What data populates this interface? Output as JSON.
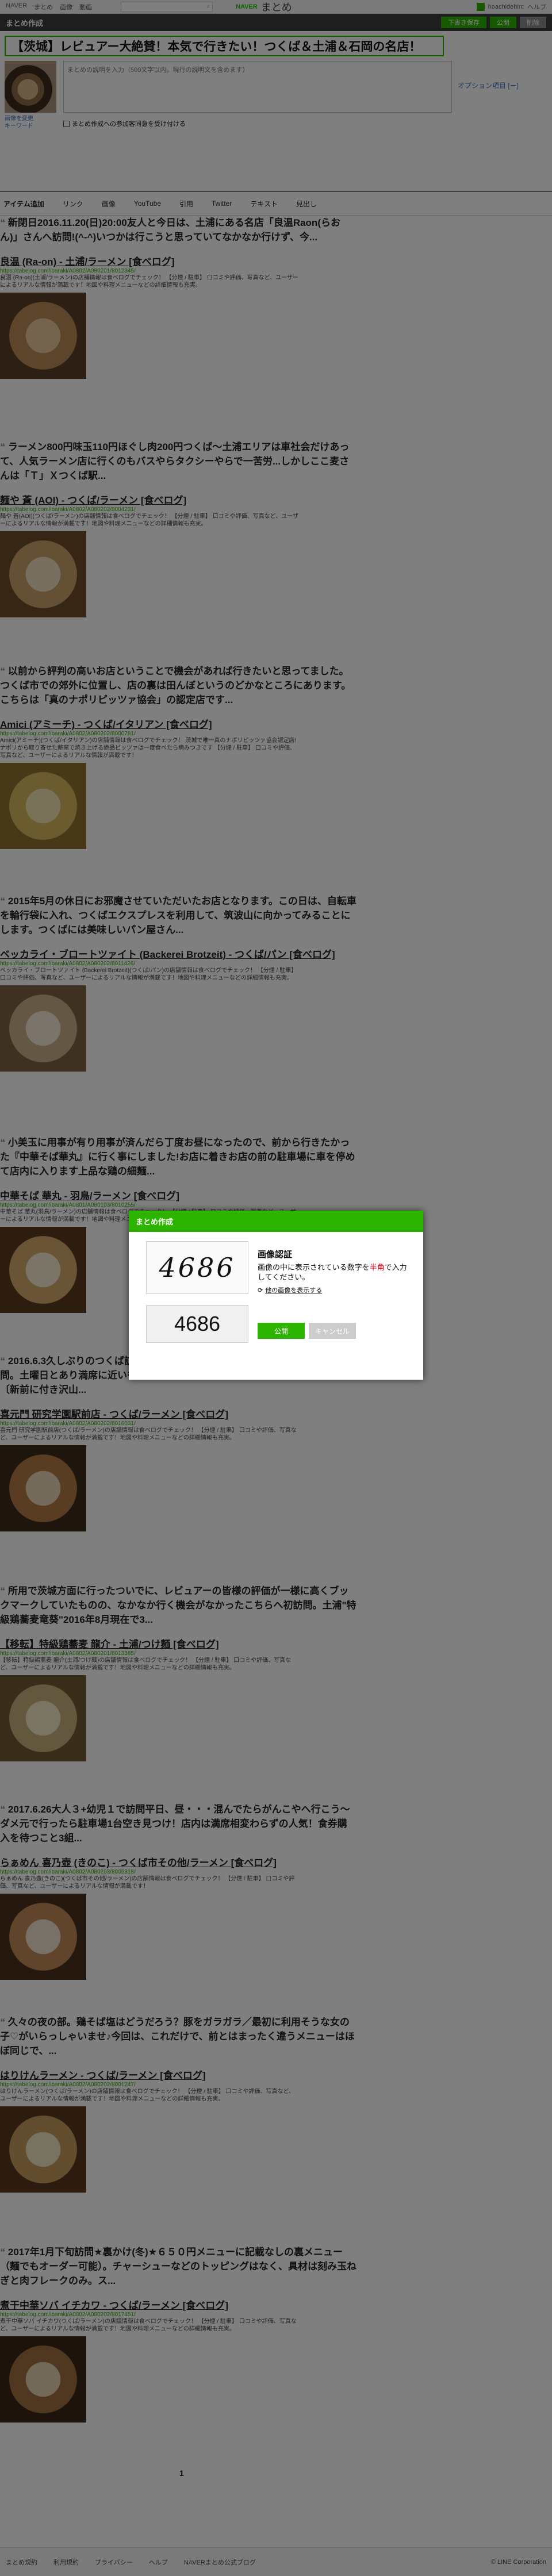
{
  "global_nav": {
    "links": [
      "NAVER",
      "まとめ",
      "画像",
      "動画"
    ],
    "brand_naver": "NAVER",
    "brand_matome": "まとめ",
    "user": "hoachidehirc",
    "help": "ヘルプ"
  },
  "editor": {
    "site_title": "まとめ作成",
    "btn_draft": "下書き保存",
    "btn_publish": "公開",
    "btn_delete": "削除"
  },
  "matome": {
    "title": "【茨城】レビュアー大絶賛！本気で行きたい！つくば＆土浦＆石岡の名店！",
    "options_link": "オプション項目 [ー]",
    "thumb_btns": [
      "画像を変更",
      "キーワード"
    ],
    "desc_placeholder": "まとめの説明を入力（500文字以内。現行の説明文を含めます）",
    "agree_label": "まとめ作成への参加客同意を受け付ける"
  },
  "toolbar": {
    "tabs": [
      "アイテム追加",
      "リンク",
      "画像",
      "YouTube",
      "引用",
      "Twitter",
      "テキスト",
      "見出し"
    ]
  },
  "items": [
    {
      "comment": "新閉日2016.11.20(日)20:00友人と今日は、土浦にある名店「良温Raon(らおん)」さんへ訪問!(^-^)いつかは行こうと思っていてなかなか行けず、今...",
      "title": "良温 (Ra-on) - 土浦/ラーメン [食べログ]",
      "url": "https://tabelog.com/ibaraki/A0802/A080201/8012345/",
      "desc": "良温 (Ra-on)(土浦/ラーメン)の店舗情報は食べログでチェック！ 【分煙 / 駐車】 口コミや評価、写真など、ユーザーによるリアルな情報が満載です！地図や料理メニューなどの詳細情報も充実。"
    },
    {
      "comment": "ラーメン800円味玉110円ほぐし肉200円つくば〜土浦エリアは車社会だけあって、人気ラーメン店に行くのもバスやらタクシーやらで一苦労...しかしここ麦さんは「Ｔ」Ｘつくば駅...",
      "title": "麺や 蒼 (AOI) - つくば/ラーメン [食べログ]",
      "url": "https://tabelog.com/ibaraki/A0802/A080202/8004231/",
      "desc": "麺や 蒼(AOI)(つくば/ラーメン)の店舗情報は食べログでチェック！ 【分煙 / 駐車】 口コミや評価、写真など、ユーザーによるリアルな情報が満載です！地図や料理メニューなどの詳細情報も充実。"
    },
    {
      "comment": "以前から評判の高いお店ということで機会があれば行きたいと思ってました。つくば市での郊外に位置し、店の裏は田んぼというのどかなところにあります。こちらは「真のナポリピッツァ協会」の認定店です...",
      "title": "Amici (アミーチ) - つくば/イタリアン [食べログ]",
      "url": "https://tabelog.com/ibaraki/A0802/A080202/8000781/",
      "desc": "Amici(アミーチ)(つくば/イタリアン)の店舗情報は食べログでチェック！ 茨城で唯一真のナポリピッツァ協会認定店!ナポリから取り寄せた薪窯で焼き上げる絶品ピッツァは一度食べたら病みつきです 【分煙 / 駐車】 口コミや評価、写真など、ユーザーによるリアルな情報が満載です！"
    },
    {
      "comment": "2015年5月の休日にお邪魔させていただいたお店となります。この日は、自転車を輪行袋に入れ、つくばエクスプレスを利用して、筑波山に向かってみることにします。つくばには美味しいパン屋さん...",
      "title": "ベッカライ・ブロートツァイト (Backerei Brotzeit) - つくば/パン [食べログ]",
      "url": "https://tabelog.com/ibaraki/A0802/A080202/8011426/",
      "desc": "ベッカライ・ブロートツァイト (Backerei Brotzeit)(つくば/パン)の店舗情報は食べログでチェック！ 【分煙 / 駐車】 口コミや評価、写真など、ユーザーによるリアルな情報が満載です！地図や料理メニューなどの詳細情報も充実。"
    },
    {
      "comment": "小美玉に用事が有り用事が済んだら丁度お昼になったので、前から行きたかった『中華そば華丸』に行く事にしました!お店に着きお店の前の駐車場に車を停めて店内に入ります上品な鶏の細麺...",
      "title": "中華そば 華丸 - 羽鳥/ラーメン [食べログ]",
      "url": "https://tabelog.com/ibaraki/A0801/A080103/8010255/",
      "desc": "中華そば 華丸(羽鳥/ラーメン)の店舗情報は食べログでチェック！ 【分煙 / 駐車】 口コミや評価、写真など、ユーザーによるリアルな情報が満載です！地図や料理メニューなどの詳細情報も充実。"
    },
    {
      "comment": "2016.6.3久しぶりのつくば訪問、研究学園駅前の「喜元門」へ...19時前後の訪問。土曜日とあり満席に近いもちろん待ち時間なし!...ここでは初めてCP利用〔新前に付き沢山...",
      "title": "喜元門 研究学園駅前店 - つくば/ラーメン [食べログ]",
      "url": "https://tabelog.com/ibaraki/A0802/A080202/8016031/",
      "desc": "喜元門 研究学園駅前店(つくば/ラーメン)の店舗情報は食べログでチェック！ 【分煙 / 駐車】 口コミや評価、写真など、ユーザーによるリアルな情報が満載です！地図や料理メニューなどの詳細情報も充実。"
    },
    {
      "comment": "所用で茨城方面に行ったついでに、レビュアーの皆様の評価が一様に高くブックマークしていたものの、なかなか行く機会がなかったこちらへ初訪問。土浦\"特級鶏蕎麦竜葵\"2016年8月現在で3...",
      "title": "【移転】特級鶏蕎麦 龍介 - 土浦/つけ麺 [食べログ]",
      "url": "https://tabelog.com/ibaraki/A0802/A080201/8013385/",
      "desc": "【移転】特級鶏蕎麦 龍介(土浦/つけ麺)の店舗情報は食べログでチェック！ 【分煙 / 駐車】 口コミや評価、写真など、ユーザーによるリアルな情報が満載です！地図や料理メニューなどの詳細情報も充実。"
    },
    {
      "comment": "2017.6.26大人３+幼児１で訪問平日、昼・・・混んでたらがんこやへ行こう〜ダメ元で行ったら駐車場1台空き見つけ！店内は満席相変わらずの人気！食券購入を待つこと3組...",
      "title": "らぁめん 喜乃壺 (きのこ) - つくば市その他/ラーメン [食べログ]",
      "url": "https://tabelog.com/ibaraki/A0802/A080203/8005318/",
      "desc": "らぁめん 喜乃壺(きのこ)(つくば市その他/ラーメン)の店舗情報は食べログでチェック！ 【分煙 / 駐車】 口コミや評価、写真など、ユーザーによるリアルな情報が満載です！"
    },
    {
      "comment": "久々の夜の部。鶏そば塩はどうだろう？豚をガラガラ／最初に利用そうな女の子♡がいらっしゃいませ♪今回は、これだけで、前とはまったく違うメニューはほぼ同じで、...",
      "title": "はりけんラーメン - つくば/ラーメン [食べログ]",
      "url": "https://tabelog.com/ibaraki/A0802/A080202/8001247/",
      "desc": "はりけんラーメン(つくば/ラーメン)の店舗情報は食べログでチェック！ 【分煙 / 駐車】 口コミや評価、写真など、ユーザーによるリアルな情報が満載です！地図や料理メニューなどの詳細情報も充実。"
    },
    {
      "comment": "2017年1月下旬訪問★裏かけ(冬)★６５０円メニューに記載なしの裏メニュー（麺でもオーダー可能）。チャーシューなどのトッピングはなく、具材は刻み玉ねぎと肉フレークのみ。ス...",
      "title": "煮干中華ソバ イチカワ - つくば/ラーメン [食べログ]",
      "url": "https://tabelog.com/ibaraki/A0802/A080202/8017451/",
      "desc": "煮干中華ソバ イチカワ(つくば/ラーメン)の店舗情報は食べログでチェック！ 【分煙 / 駐車】 口コミや評価、写真など、ユーザーによるリアルな情報が満載です！地図や料理メニューなどの詳細情報も充実。"
    }
  ],
  "pagination": {
    "current": "1"
  },
  "footer": {
    "links": [
      "まとめ規約",
      "利用規約",
      "プライバシー",
      "ヘルプ",
      "NAVERまとめ公式ブログ"
    ],
    "copyright": "© LINE Corporation"
  },
  "captcha_modal": {
    "header": "まとめ作成",
    "captcha_text": "4686",
    "title": "画像認証",
    "help_before": "画像の中に表示されている数字を",
    "help_red": "半角",
    "help_after": "で入力してください。",
    "refresh_label": "他の画像を表示する",
    "input_value": "4686",
    "ok_label": "公開",
    "cancel_label": "キャンセル"
  },
  "colors": {
    "accent": "#2db400",
    "overlay": "#000000"
  }
}
